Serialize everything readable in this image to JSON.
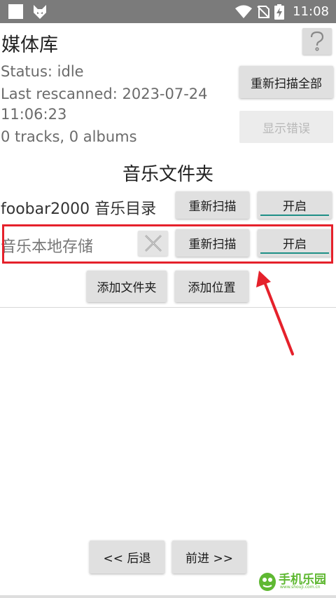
{
  "status_bar": {
    "time": "11:08",
    "icons": [
      "square-icon",
      "fox-icon",
      "wifi-icon",
      "no-sim-icon",
      "battery-charging-icon"
    ]
  },
  "header": {
    "title": "媒体库",
    "help_label": "?"
  },
  "status": {
    "status_line": "Status: idle",
    "last_rescanned_line1": "Last rescanned: 2023-07-24",
    "last_rescanned_line2": "11:06:23",
    "counts": "0 tracks, 0 albums"
  },
  "actions": {
    "rescan_all": "重新扫描全部",
    "show_errors": "显示错误"
  },
  "folders_section": {
    "title": "音乐文件夹",
    "items": [
      {
        "label": "foobar2000 音乐目录",
        "rescan": "重新扫描",
        "toggle": "开启"
      },
      {
        "label": "音乐本地存储",
        "rescan": "重新扫描",
        "toggle": "开启"
      }
    ],
    "add_folder": "添加文件夹",
    "add_location": "添加位置"
  },
  "navigation": {
    "back": "<< 后退",
    "forward": "前进 >>"
  },
  "annotation": {
    "highlight_color": "#e5212b"
  },
  "watermark": {
    "text": "手机乐园",
    "subtext": "www.shouji.com.cn",
    "color": "#5fb832"
  },
  "colors": {
    "statusbar": "#7b7b7b",
    "button": "#e0e0e0",
    "toggle_accent": "#1e8f86"
  }
}
